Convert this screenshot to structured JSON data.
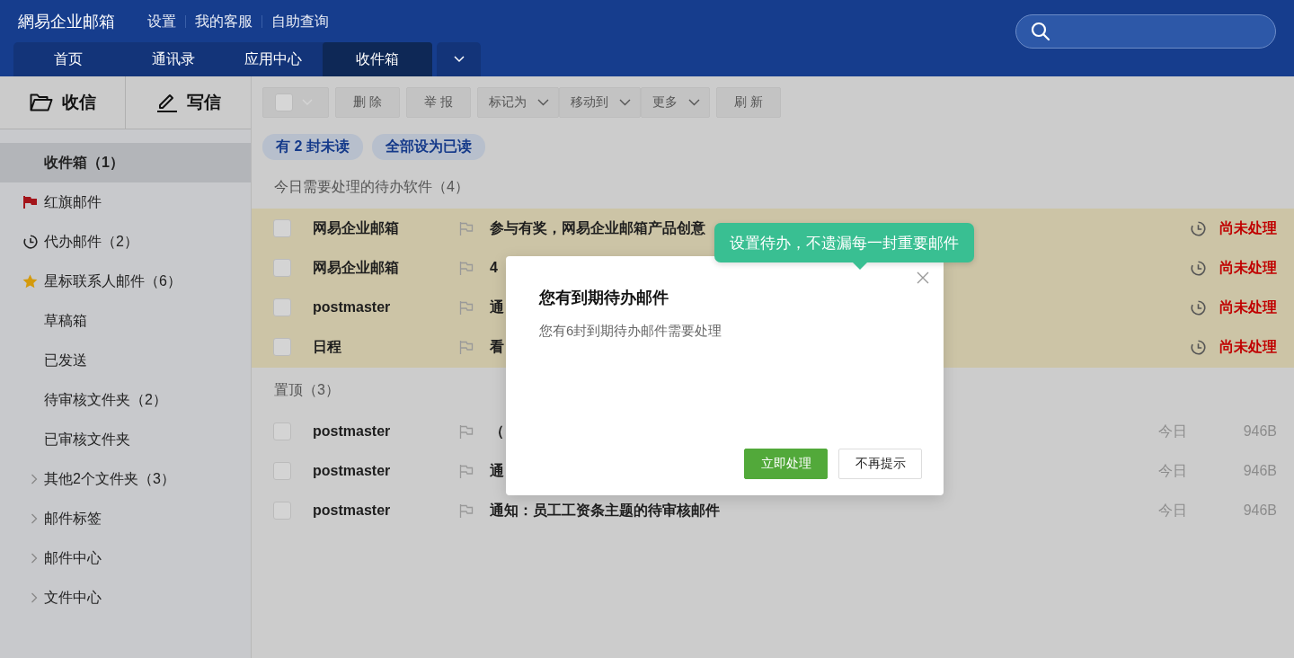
{
  "header": {
    "brand": "網易企业邮箱",
    "links": [
      "设置",
      "我的客服",
      "自助查询"
    ],
    "tabs": [
      {
        "label": "首页",
        "selected": false
      },
      {
        "label": "通讯录",
        "selected": false
      },
      {
        "label": "应用中心",
        "selected": false
      },
      {
        "label": "收件箱",
        "selected": true
      }
    ]
  },
  "sidebar": {
    "actions": [
      {
        "label": "收信",
        "kind": "receive"
      },
      {
        "label": "写信",
        "kind": "compose"
      }
    ],
    "folders": [
      {
        "label": "收件箱（1）",
        "kind": "plain",
        "selected": true
      },
      {
        "label": "红旗邮件",
        "kind": "flag",
        "selected": false
      },
      {
        "label": "代办邮件（2）",
        "kind": "clock",
        "selected": false
      },
      {
        "label": "星标联系人邮件（6）",
        "kind": "star",
        "selected": false
      },
      {
        "label": "草稿箱",
        "kind": "plain",
        "selected": false
      },
      {
        "label": "已发送",
        "kind": "plain",
        "selected": false
      },
      {
        "label": "待审核文件夹（2）",
        "kind": "plain",
        "selected": false
      },
      {
        "label": "已审核文件夹",
        "kind": "plain",
        "selected": false
      },
      {
        "label": "其他2个文件夹（3）",
        "kind": "group",
        "selected": false
      },
      {
        "label": "邮件标签",
        "kind": "group",
        "selected": false
      },
      {
        "label": "邮件中心",
        "kind": "group",
        "selected": false
      },
      {
        "label": "文件中心",
        "kind": "group",
        "selected": false
      }
    ]
  },
  "toolbar": [
    {
      "kind": "checkbox",
      "checked": false
    },
    {
      "label": "删 除",
      "kind": "button"
    },
    {
      "label": "举 报",
      "kind": "button"
    },
    {
      "label": "标记为",
      "kind": "menu"
    },
    {
      "label": "移动到",
      "kind": "menu"
    },
    {
      "label": "更多",
      "kind": "menu"
    },
    {
      "label": "刷 新",
      "kind": "button"
    }
  ],
  "chips": [
    "有 2 封未读",
    "全部设为已读"
  ],
  "sections": [
    {
      "title": "今日需要处理的待办软件（4）",
      "kind": "todo",
      "rows": [
        {
          "sender": "网易企业邮箱",
          "subject": "参与有奖，网易企业邮箱产品创意",
          "status": "尚未处理",
          "checked": false
        },
        {
          "sender": "网易企业邮箱",
          "subject": "4",
          "status": "尚未处理",
          "checked": false
        },
        {
          "sender": "postmaster",
          "subject": "通",
          "status": "尚未处理",
          "checked": false
        },
        {
          "sender": "日程",
          "subject": "看",
          "status": "尚未处理",
          "checked": false
        }
      ]
    },
    {
      "title": "置顶（3）",
      "kind": "pinned",
      "rows": [
        {
          "sender": "postmaster",
          "subject": "（",
          "date": "今日",
          "size": "946B",
          "checked": false
        },
        {
          "sender": "postmaster",
          "subject": "通",
          "date": "今日",
          "size": "946B",
          "checked": false
        },
        {
          "sender": "postmaster",
          "subject": "通知：员工工资条主题的待审核邮件",
          "date": "今日",
          "size": "946B",
          "checked": false
        }
      ]
    }
  ],
  "modal": {
    "title": "您有到期待办邮件",
    "message": "您有6封到期待办邮件需要处理",
    "buttons": [
      {
        "label": "立即处理",
        "kind": "primary"
      },
      {
        "label": "不再提示",
        "kind": "secondary"
      }
    ]
  },
  "tooltip": "设置待办，不遗漏每一封重要邮件"
}
